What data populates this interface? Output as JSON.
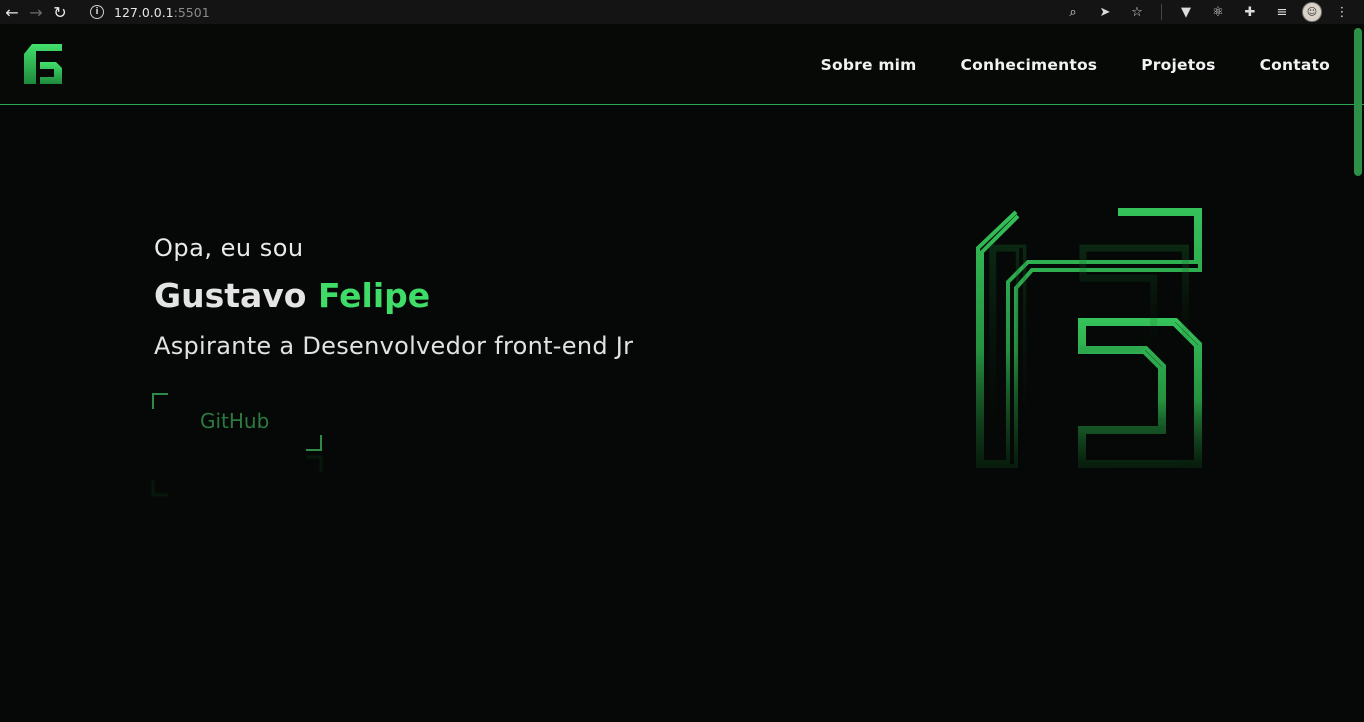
{
  "browser": {
    "url_host": "127.0.0.1",
    "url_port": ":5501"
  },
  "header": {
    "nav": [
      {
        "label": "Sobre mim"
      },
      {
        "label": "Conhecimentos"
      },
      {
        "label": "Projetos"
      },
      {
        "label": "Contato"
      }
    ]
  },
  "hero": {
    "greeting": "Opa, eu sou",
    "first_name": "Gustavo",
    "last_name": "Felipe",
    "role": "Aspirante a Desenvolvedor front-end Jr",
    "github_label": "GitHub"
  },
  "colors": {
    "accent": "#3fdc68",
    "background": "#050806",
    "header_border": "#2ea64f"
  }
}
